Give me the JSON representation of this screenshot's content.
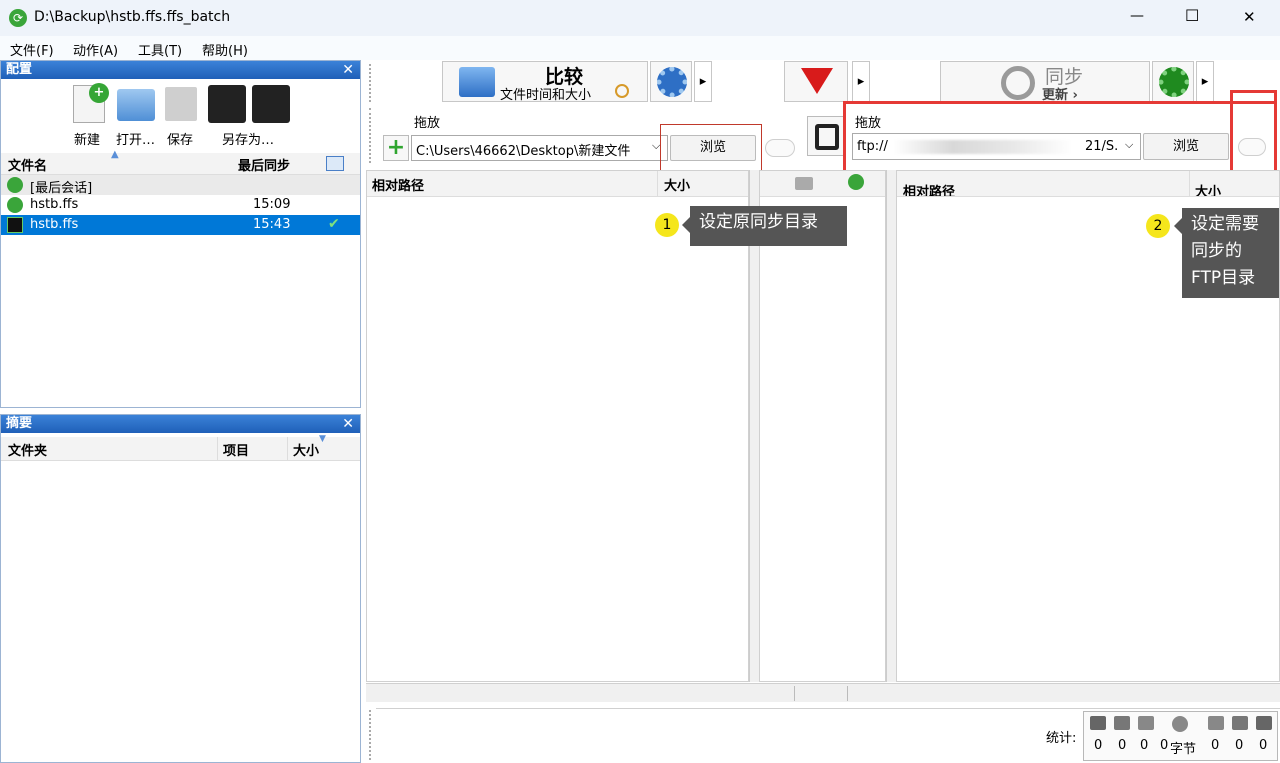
{
  "window": {
    "title": "D:\\Backup\\hstb.ffs.ffs_batch",
    "minimize": "—",
    "maximize": "☐",
    "close": "✕"
  },
  "menu": [
    "文件(F)",
    "动作(A)",
    "工具(T)",
    "帮助(H)"
  ],
  "config_panel": {
    "title": "配置",
    "close": "✕",
    "tools": [
      {
        "label": "新建",
        "icon": "new-config-icon"
      },
      {
        "label": "打开…",
        "icon": "open-config-icon"
      },
      {
        "label": "保存",
        "icon": "save-icon"
      },
      {
        "label": "另存为…",
        "icon": "save-as-icon"
      }
    ],
    "headers": {
      "name": "文件名",
      "last_sync": "最后同步"
    },
    "rows": [
      {
        "name": "[最后会话]",
        "time": ""
      },
      {
        "name": "hstb.ffs",
        "time": "15:09"
      },
      {
        "name": "hstb.ffs",
        "time": "15:43",
        "selected": true,
        "check": "✔"
      }
    ]
  },
  "summary_panel": {
    "title": "摘要",
    "close": "✕",
    "headers": {
      "folder": "文件夹",
      "items": "项目",
      "size": "大小"
    }
  },
  "toolbar": {
    "compare": {
      "title": "比较",
      "subtitle": "文件时间和大小"
    },
    "sync": {
      "title": "同步",
      "subtitle": "更新 ›"
    },
    "arrow": "▸"
  },
  "left_folder": {
    "label": "拖放",
    "path": "C:\\Users\\46662\\Desktop\\新建文件",
    "browse": "浏览",
    "col_path": "相对路径",
    "col_size": "大小"
  },
  "right_folder": {
    "label": "拖放",
    "path": "ftp://",
    "path_tail": "21/S.",
    "browse": "浏览",
    "col_path": "相对路径",
    "col_size": "大小"
  },
  "annotations": [
    {
      "num": "1",
      "text": "设定原同步目录"
    },
    {
      "num": "2",
      "text": "设定需要\n同步的\nFTP目录"
    }
  ],
  "stats": {
    "label": "统计:",
    "values": [
      "0",
      "0",
      "0",
      "0",
      "0",
      "0",
      "0"
    ],
    "bytes_unit": "字节"
  },
  "colors": {
    "accent": "#0078d7",
    "red_box": "#e53935",
    "callout_bg": "#555555",
    "badge": "#f5e61c"
  }
}
